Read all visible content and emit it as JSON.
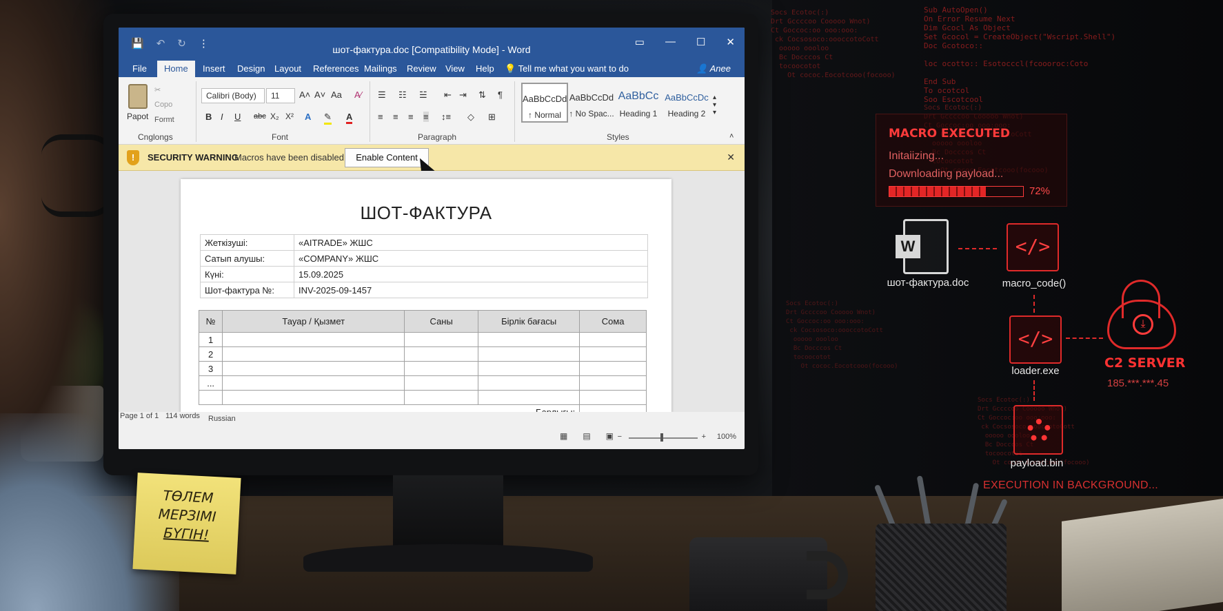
{
  "window": {
    "title": "шот-фактура.doc [Compatibility Mode]  -  Word",
    "qat": {
      "save": "💾",
      "undo": "↶",
      "redo": "↻",
      "more": "⋮"
    },
    "controls": {
      "ribbon_opts": "▭",
      "minimize": "—",
      "maximize": "☐",
      "close": "✕"
    }
  },
  "tabs": [
    {
      "label": "File"
    },
    {
      "label": "Home"
    },
    {
      "label": "Insert"
    },
    {
      "label": "Design"
    },
    {
      "label": "Layout"
    },
    {
      "label": "References"
    },
    {
      "label": "Mailings"
    },
    {
      "label": "Review"
    },
    {
      "label": "View"
    },
    {
      "label": "Help"
    }
  ],
  "tellme": "Tell me what you want to do",
  "share": "Anee",
  "ribbon": {
    "clipboard": {
      "paste": "Papot",
      "cut": "✂",
      "copy": "Copo",
      "format": "Formt",
      "label": "Cnglongs"
    },
    "font": {
      "family": "Calibri (Body)",
      "size": "11",
      "label": "Font",
      "bold": "B",
      "italic": "I",
      "underline": "U",
      "strike": "abc",
      "sub": "X₂",
      "sup": "X²"
    },
    "paragraph": {
      "label": "Paragraph"
    },
    "styles": {
      "label": "Styles",
      "items": [
        {
          "sample": "AaBbCcDd",
          "name": "↑ Normal"
        },
        {
          "sample": "AaBbCcDd",
          "name": "↑ No Spac..."
        },
        {
          "sample": "AaBbCc",
          "name": "Heading 1"
        },
        {
          "sample": "AaBbCcDc",
          "name": "Heading 2"
        }
      ]
    }
  },
  "security": {
    "title": "SECURITY WARNING",
    "message": "Macros have been disabled.",
    "button": "Enable Content",
    "shield": "!",
    "close": "✕"
  },
  "document": {
    "heading": "ШОТ-ФАКТУРА",
    "info": [
      {
        "key": "Жеткізуші:",
        "value": "«AITRADE» ЖШС"
      },
      {
        "key": "Сатып алушы:",
        "value": "«COMPANY» ЖШС"
      },
      {
        "key": "Күні:",
        "value": "15.09.2025"
      },
      {
        "key": "Шот-фактура №:",
        "value": "INV-2025-09-1457"
      }
    ],
    "items_headers": [
      "№",
      "Тауар / Қызмет",
      "Саны",
      "Бірлік бағасы",
      "Сома"
    ],
    "rows": [
      "1",
      "2",
      "3",
      "...",
      ""
    ],
    "total_label": "Барлығы:"
  },
  "statusbar": {
    "page": "Page 1 of 1",
    "words": "114 words",
    "language": "Russian",
    "zoom": "100%",
    "zoom_level_percent": 100
  },
  "sticky_note": {
    "line1": "ТӨЛЕМ",
    "line2": "МЕРЗІМІ",
    "line3": "БҮГІН!"
  },
  "attack": {
    "panel_title": "MACRO EXECUTED",
    "line1": "Initaiizing...",
    "line2": "Downloading payload...",
    "progress_percent": 72,
    "progress_text": "72%",
    "doc_label": "шот-фактура.doc",
    "macro_label": "macro_code()",
    "loader_label": "loader.exe",
    "payload_label": "payload.bin",
    "c2_title": "C2 SERVER",
    "c2_ip": "185.***.***.45",
    "footer": "EXECUTION IN BACKGROUND...",
    "code_glyph": "</>",
    "cloud_glyph": "⤓"
  },
  "code_lines": {
    "right_top": "Sub AutoOpen()\nOn Error Resume Next\nDim Gcocl As Object\nSet Gcocol = CreateObject(\"Wscript.Shell\")\nDoc Gcotoco::\n\nloc ocotto:: Esotocccl(fcoooroc:Coto\n\nEnd Sub\nTo ocotcol\nSoo Escotcool",
    "left_top": "Socs Ecotoc(:)\nDrt Gccccoo Cooooo Wnot)\nCt Goccoc:oo ooo:ooo:\n ck Cocsosoco:oooccotoCott\n  ooooo oooloo\n  Bc Docccos Ct\n  tocoocotot\n    Ot cococ.Eocotcooo(focooo)"
  },
  "colors": {
    "word_blue": "#2b579a",
    "alert_red": "#ff3b3b",
    "warning_yellow": "#f6e7a8"
  }
}
